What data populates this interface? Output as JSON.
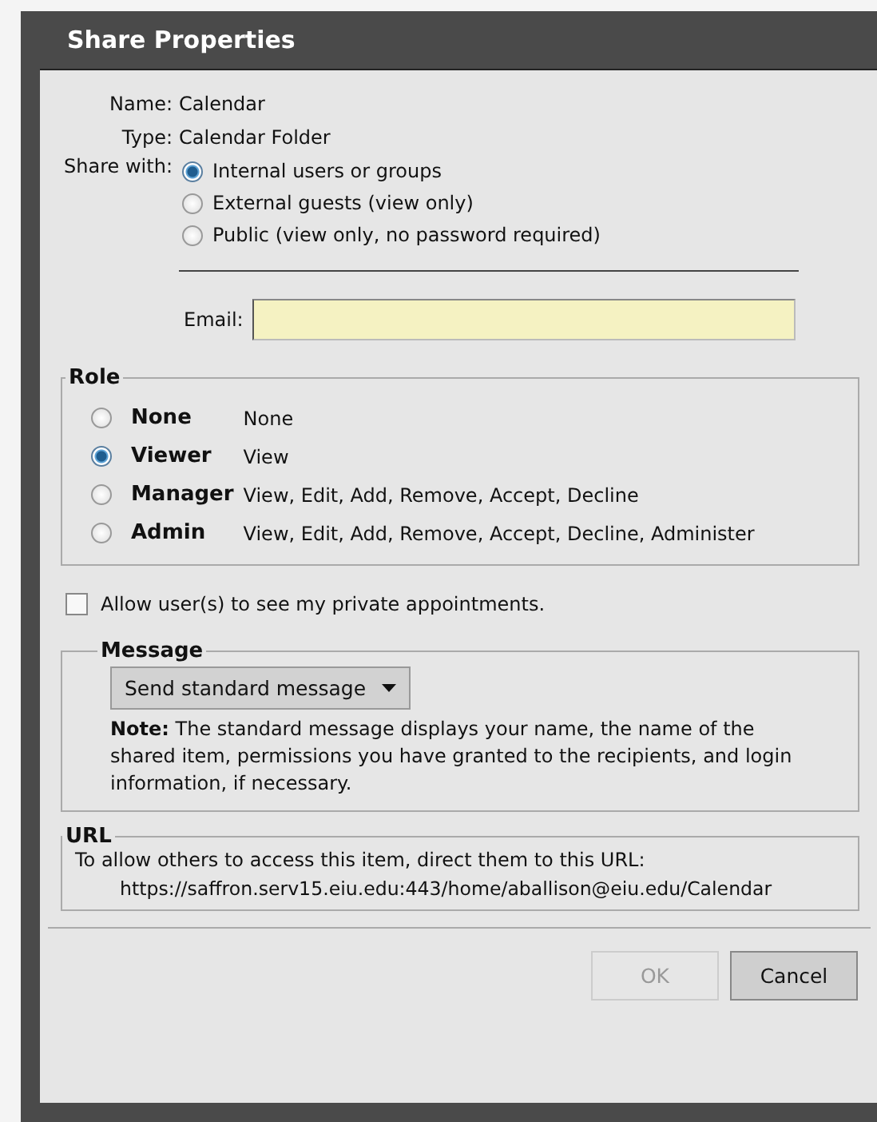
{
  "dialog": {
    "title": "Share Properties",
    "name": {
      "label": "Name:",
      "value": "Calendar"
    },
    "type": {
      "label": "Type:",
      "value": "Calendar Folder"
    },
    "share_with": {
      "label": "Share with:",
      "options": [
        {
          "label": "Internal users or groups",
          "selected": true
        },
        {
          "label": "External guests (view only)",
          "selected": false
        },
        {
          "label": "Public (view only, no password required)",
          "selected": false
        }
      ]
    },
    "email": {
      "label": "Email:"
    },
    "role": {
      "legend": "Role",
      "options": [
        {
          "name": "None",
          "permissions": "None",
          "selected": false
        },
        {
          "name": "Viewer",
          "permissions": "View",
          "selected": true
        },
        {
          "name": "Manager",
          "permissions": "View, Edit, Add, Remove, Accept, Decline",
          "selected": false
        },
        {
          "name": "Admin",
          "permissions": "View, Edit, Add, Remove, Accept, Decline, Administer",
          "selected": false
        }
      ]
    },
    "private_appointments": {
      "label": "Allow user(s) to see my private appointments.",
      "checked": false
    },
    "message": {
      "legend": "Message",
      "dropdown": "Send standard message",
      "note": "**Note:** The standard message displays your name, the name of the shared item, permissions you have granted to the recipients, and login information, if necessary."
    },
    "url": {
      "legend": "URL",
      "text": "To allow others to access this item, direct them to this URL:",
      "link": "https://saffron.serv15.eiu.edu:443/home/aballison@eiu.edu/Calendar"
    },
    "buttons": [
      {
        "label": "OK",
        "disabled": true
      },
      {
        "label": "Cancel",
        "disabled": false
      }
    ]
  }
}
